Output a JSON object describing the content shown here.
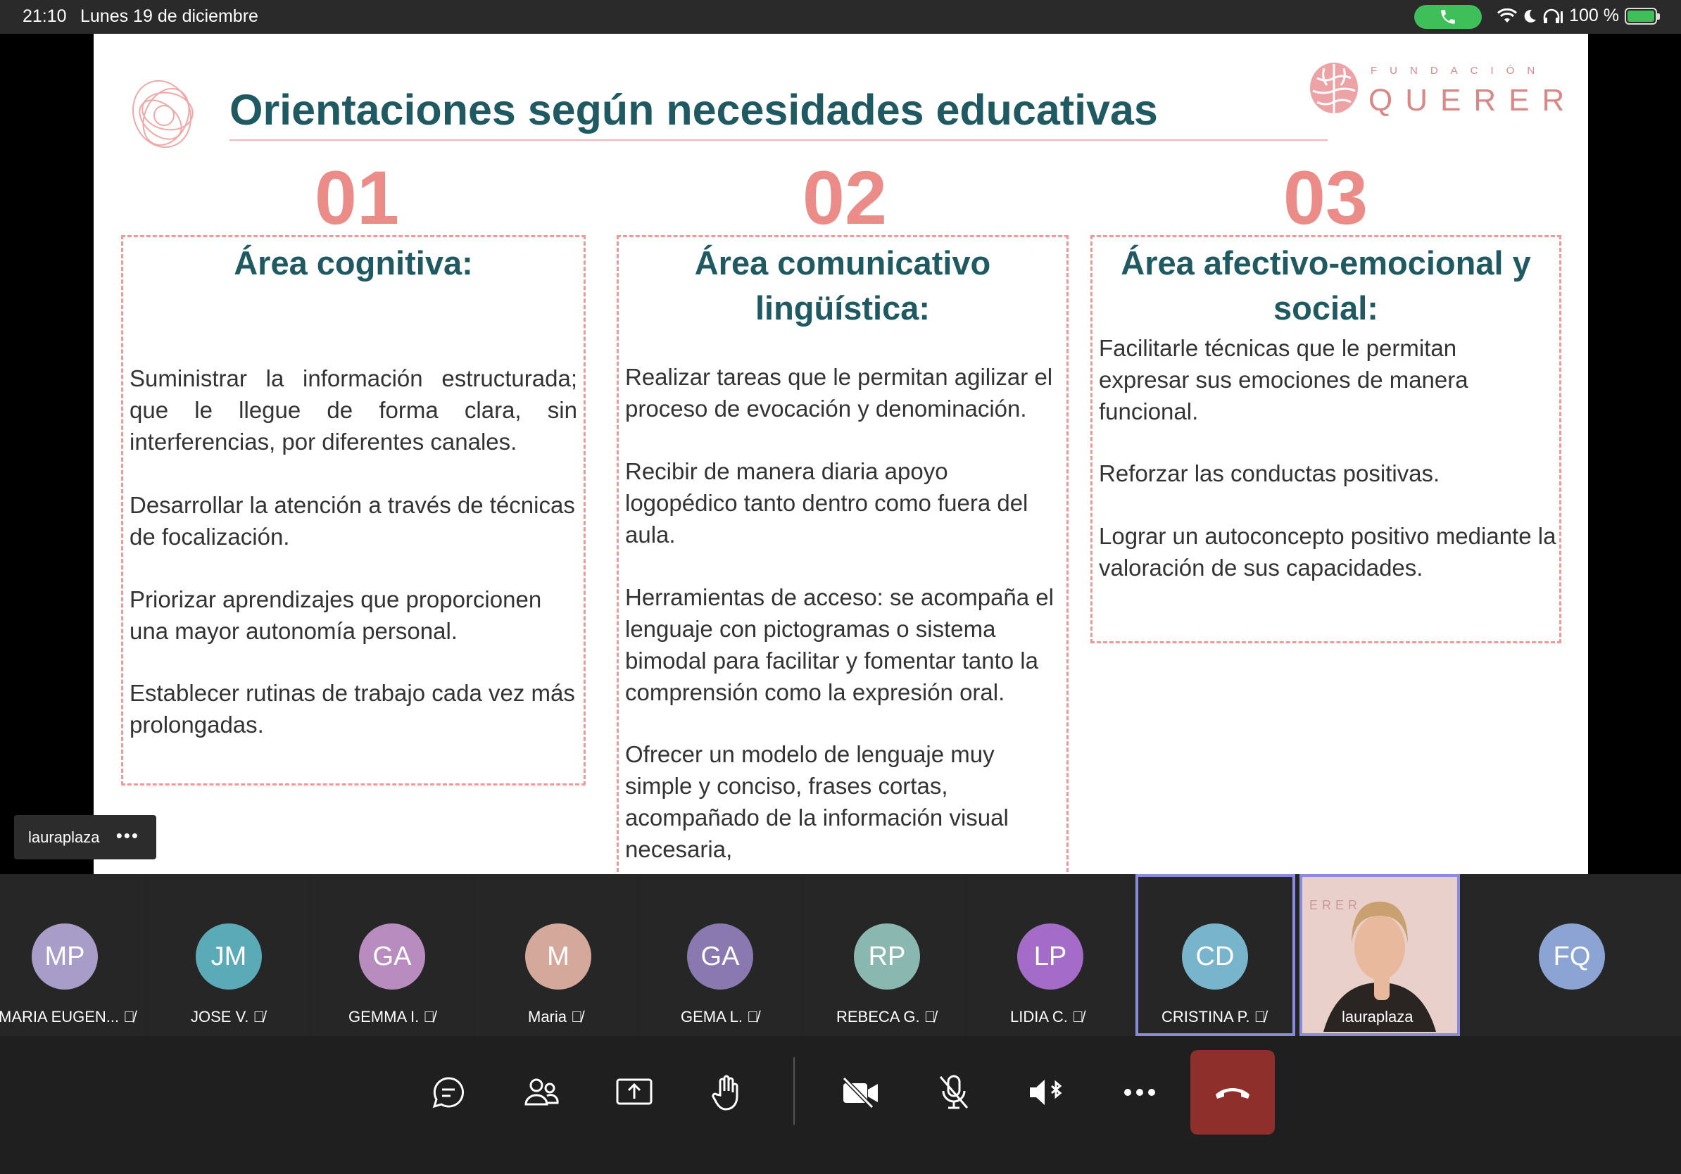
{
  "status_bar": {
    "time": "21:10",
    "date": "Lunes 19 de diciembre",
    "battery": "100 %",
    "icons": [
      "phone-icon",
      "wifi-icon",
      "moon-icon",
      "headphones-icon",
      "battery-charging-icon"
    ]
  },
  "slide": {
    "title": "Orientaciones según necesidades educativas",
    "logo_small": "FUNDACIÓN",
    "logo_big": "QUERER",
    "columns": [
      {
        "number": "01",
        "heading_lines": [
          "Área cognitiva:"
        ],
        "items": [
          "Suministrar la información estructurada; que le llegue de forma clara, sin interferencias, por diferentes canales.",
          "Desarrollar la atención a través de técnicas de focalización.",
          "Priorizar aprendizajes que proporcionen una mayor autonomía personal.",
          "Establecer rutinas de trabajo cada vez más prolongadas."
        ]
      },
      {
        "number": "02",
        "heading_lines": [
          "Área comunicativo",
          "lingüística:"
        ],
        "items": [
          "Realizar tareas que le permitan agilizar el proceso de evocación y denominación.",
          "Recibir de manera diaria apoyo logopédico tanto dentro como fuera del aula.",
          "Herramientas de acceso: se acompaña el lenguaje con pictogramas o sistema bimodal para facilitar y fomentar tanto la comprensión como la expresión oral.",
          "Ofrecer un  modelo de lenguaje muy simple y conciso, frases cortas, acompañado de la información visual necesaria,"
        ]
      },
      {
        "number": "03",
        "heading_lines": [
          "Área afectivo-emocional y",
          "social:"
        ],
        "items": [
          "Facilitarle técnicas que le permitan expresar sus emociones de manera funcional.",
          "Reforzar las conductas positivas.",
          "Lograr un autoconcepto positivo mediante la valoración de sus capacidades."
        ]
      }
    ]
  },
  "speaker_tag": {
    "name": "lauraplaza",
    "more": "•••"
  },
  "participants": [
    {
      "initials": "MP",
      "name": "MARIA EUGEN...",
      "color": "#a89cc8"
    },
    {
      "initials": "JM",
      "name": "JOSE V.",
      "color": "#5aaab8"
    },
    {
      "initials": "GA",
      "name": "GEMMA I.",
      "color": "#b98cc0"
    },
    {
      "initials": "M",
      "name": "Maria",
      "color": "#d4a89a"
    },
    {
      "initials": "GA",
      "name": "GEMA L.",
      "color": "#8a78b0"
    },
    {
      "initials": "RP",
      "name": "REBECA G.",
      "color": "#8ab8b0"
    },
    {
      "initials": "LP",
      "name": "LIDIA C.",
      "color": "#a46cc8"
    },
    {
      "initials": "CD",
      "name": "CRISTINA P.",
      "color": "#78b4cc"
    },
    {
      "initials": "",
      "name": "lauraplaza",
      "color": "#e9c9c4"
    },
    {
      "initials": "FQ",
      "name": "",
      "color": "#8ca4d4"
    }
  ],
  "video_tile_label": "ERER",
  "toolbar": {
    "buttons": [
      "chat-icon",
      "people-icon",
      "share-screen-icon",
      "raise-hand-icon",
      "camera-off-icon",
      "mic-off-icon",
      "speaker-bluetooth-icon",
      "more-icon",
      "hang-up-icon"
    ]
  }
}
